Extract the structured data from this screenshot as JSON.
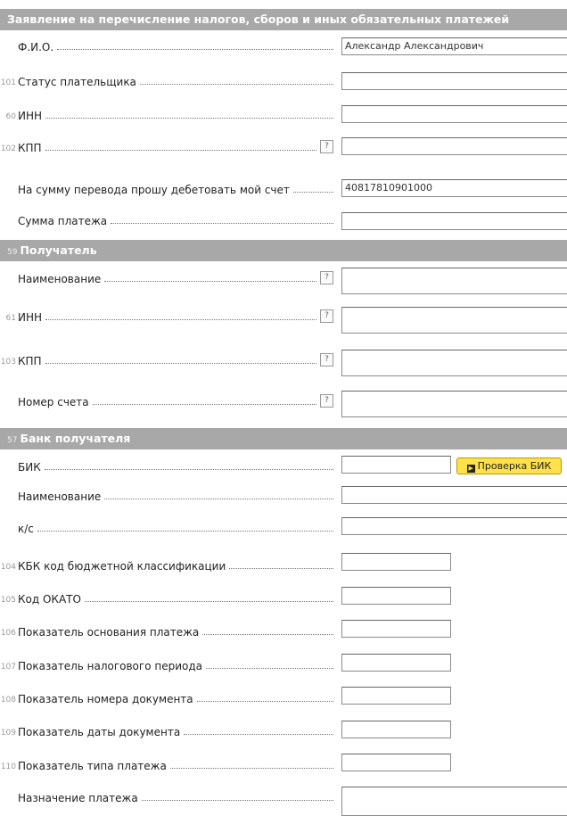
{
  "form": {
    "title": "Заявление на перечисление налогов, сборов и иных обязательных платежей",
    "payer": {
      "fio_label": "Ф.И.О.",
      "fio_value": "Александр Александрович",
      "status_num": "101",
      "status_label": "Статус плательщика",
      "inn_num": "60",
      "inn_label": "ИНН",
      "kpp_num": "102",
      "kpp_label": "КПП",
      "debit_label": "На сумму перевода прошу дебетовать мой счет",
      "debit_value": "40817810901000",
      "amount_label": "Сумма платежа"
    },
    "recipient": {
      "section_num": "59",
      "section_title": "Получатель",
      "name_label": "Наименование",
      "inn_num": "61",
      "inn_label": "ИНН",
      "kpp_num": "103",
      "kpp_label": "КПП",
      "account_label": "Номер счета"
    },
    "bank": {
      "section_num": "57",
      "section_title": "Банк получателя",
      "bik_label": "БИК",
      "check_bik_button": "Проверка БИК",
      "name_label": "Наименование",
      "ks_label": "к/с"
    },
    "budget": {
      "kbk_num": "104",
      "kbk_label": "КБК код бюджетной классификации",
      "okato_num": "105",
      "okato_label": "Код ОКАТО",
      "basis_num": "106",
      "basis_label": "Показатель основания платежа",
      "period_num": "107",
      "period_label": "Показатель налогового периода",
      "docnum_num": "108",
      "docnum_label": "Показатель номера документа",
      "docdate_num": "109",
      "docdate_label": "Показатель даты документа",
      "type_num": "110",
      "type_label": "Показатель типа платежа",
      "purpose_label": "Назначение платежа"
    },
    "help_glyph": "?"
  }
}
